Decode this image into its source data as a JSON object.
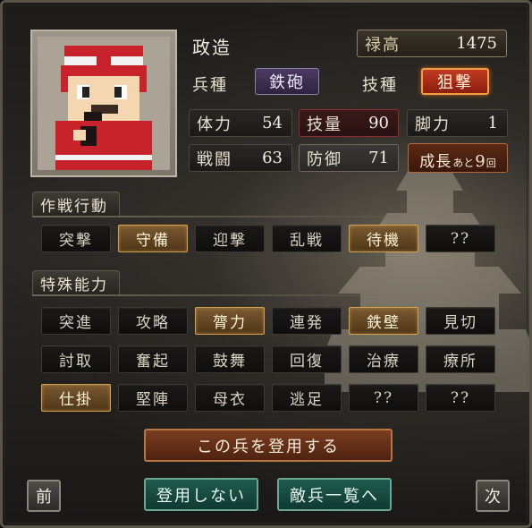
{
  "officer": {
    "name": "政造",
    "salary_label": "禄高",
    "salary_value": "1475",
    "unit_label": "兵種",
    "unit_value": "鉄砲",
    "skill_label": "技種",
    "skill_value": "狙撃"
  },
  "stats": [
    {
      "label": "体力",
      "value": "54"
    },
    {
      "label": "技量",
      "value": "90"
    },
    {
      "label": "脚力",
      "value": "1"
    },
    {
      "label": "戦闘",
      "value": "63"
    },
    {
      "label": "防御",
      "value": "71"
    }
  ],
  "growth": {
    "prefix": "成長",
    "mid": "あと",
    "num": "9",
    "suffix": "回"
  },
  "tactics": {
    "title": "作戦行動",
    "items": [
      {
        "label": "突撃",
        "active": false
      },
      {
        "label": "守備",
        "active": true
      },
      {
        "label": "迎撃",
        "active": false
      },
      {
        "label": "乱戦",
        "active": false
      },
      {
        "label": "待機",
        "active": true
      },
      {
        "label": "??",
        "active": false
      }
    ]
  },
  "abilities": {
    "title": "特殊能力",
    "items": [
      {
        "label": "突進",
        "active": false
      },
      {
        "label": "攻略",
        "active": false
      },
      {
        "label": "膂力",
        "active": true
      },
      {
        "label": "連発",
        "active": false
      },
      {
        "label": "鉄壁",
        "active": true
      },
      {
        "label": "見切",
        "active": false
      },
      {
        "label": "討取",
        "active": false
      },
      {
        "label": "奮起",
        "active": false
      },
      {
        "label": "鼓舞",
        "active": false
      },
      {
        "label": "回復",
        "active": false
      },
      {
        "label": "治療",
        "active": false
      },
      {
        "label": "療所",
        "active": false
      },
      {
        "label": "仕掛",
        "active": true
      },
      {
        "label": "堅陣",
        "active": false
      },
      {
        "label": "母衣",
        "active": false
      },
      {
        "label": "逃足",
        "active": false
      },
      {
        "label": "??",
        "active": false
      },
      {
        "label": "??",
        "active": false
      }
    ]
  },
  "actions": {
    "recruit": "この兵を登用する",
    "no_recruit": "登用しない",
    "enemy_list": "敵兵一覧へ",
    "prev": "前",
    "next": "次"
  },
  "colors": {
    "active_gold": "#d4a24e",
    "skill_red": "#c23a22",
    "unit_purple": "#4b3a62",
    "teal": "#1e5a4e"
  }
}
